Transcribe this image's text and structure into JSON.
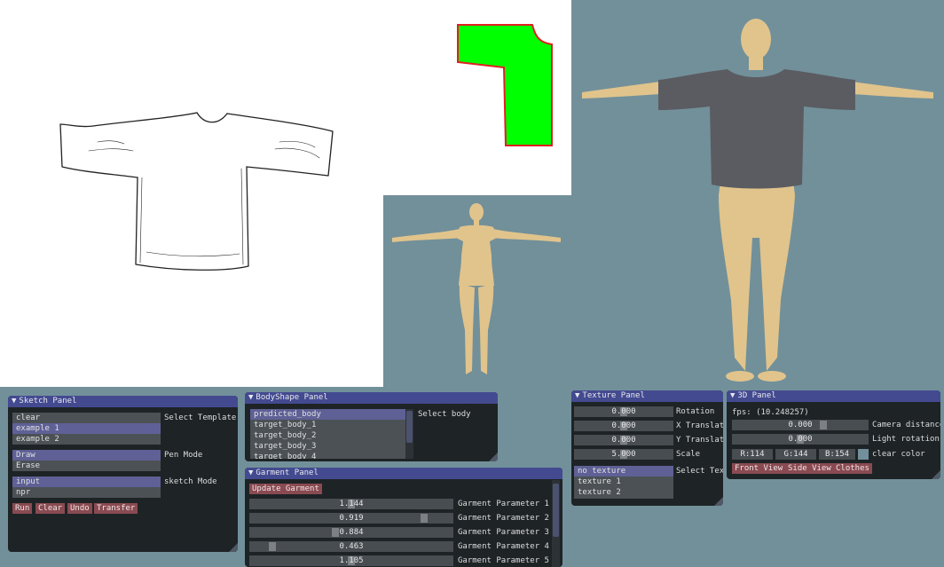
{
  "colors": {
    "background": "#72909a",
    "panel_bg": "#1e2326",
    "title_bar": "#434a8f",
    "selected_item": "#5f6196",
    "button": "#8a4a52",
    "pattern_fill": "#00ff00",
    "pattern_stroke": "#e02020",
    "clear_color": "#72909a"
  },
  "viewport": {
    "body_color": "#e0c48c",
    "shirt_color": "#5a5c62"
  },
  "sketch_panel": {
    "title": "Sketch Panel",
    "templates": [
      "clear",
      "example 1",
      "example 2"
    ],
    "templates_selected": 1,
    "template_label": "Select Template",
    "pen_modes": [
      "Draw",
      "Erase"
    ],
    "pen_label": "Pen Mode",
    "sketch_modes": [
      "input",
      "npr"
    ],
    "sketch_label": "sketch Mode",
    "buttons": {
      "run": "Run",
      "clear": "Clear",
      "undo": "Undo",
      "transfer": "Transfer"
    }
  },
  "bodyshape_panel": {
    "title": "BodyShape Panel",
    "bodies": [
      "predicted_body",
      "target_body_1",
      "target_body_2",
      "target_body_3",
      "target_body_4"
    ],
    "label": "Select body"
  },
  "garment_panel": {
    "title": "Garment Panel",
    "update_button": "Update Garment",
    "params": [
      {
        "label": "Garment Parameter 1",
        "value": "1.144",
        "fraction": 0.5
      },
      {
        "label": "Garment Parameter 2",
        "value": "0.919",
        "fraction": 0.87
      },
      {
        "label": "Garment Parameter 3",
        "value": "0.884",
        "fraction": 0.42
      },
      {
        "label": "Garment Parameter 4",
        "value": "0.463",
        "fraction": 0.1
      },
      {
        "label": "Garment Parameter 5",
        "value": "1.105",
        "fraction": 0.5
      }
    ]
  },
  "texture_panel": {
    "title": "Texture Panel",
    "sliders": [
      {
        "label": "Rotation",
        "value": "0.000"
      },
      {
        "label": "X Translat",
        "value": "0.000"
      },
      {
        "label": "Y Translat",
        "value": "0.000"
      },
      {
        "label": "Scale",
        "value": "5.000"
      }
    ],
    "textures": [
      "no texture",
      "texture 1",
      "texture 2"
    ],
    "texture_label": "Select Tex"
  },
  "panel_3d": {
    "title": "3D Panel",
    "fps": "fps: (10.248257)",
    "camera_distance": {
      "label": "Camera distance",
      "value": "0.000"
    },
    "light_rotation": {
      "label": "Light rotation",
      "value": "0.000"
    },
    "color": {
      "r": "R:114",
      "g": "G:144",
      "b": "B:154",
      "label": "clear color"
    },
    "buttons": {
      "front": "Front View",
      "side": "Side View",
      "clothes": "Clothes"
    }
  }
}
